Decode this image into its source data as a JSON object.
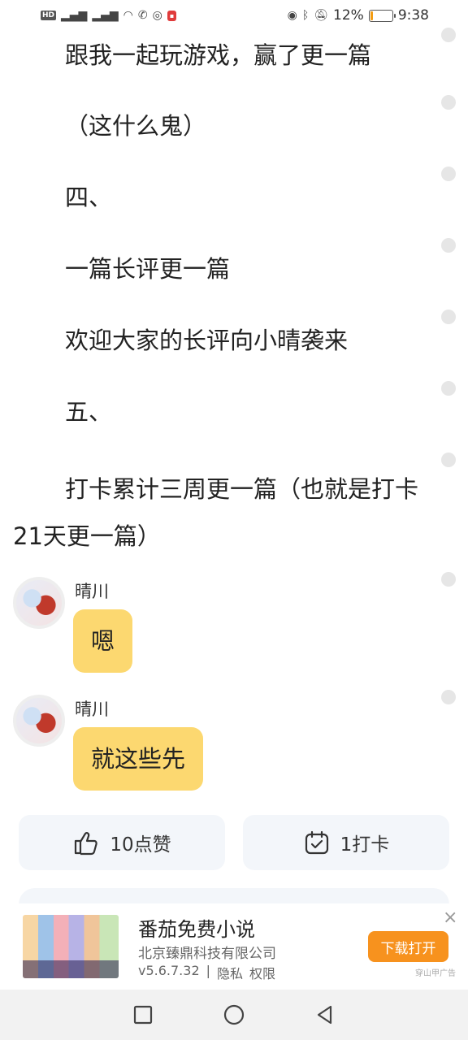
{
  "status_bar": {
    "left_icons": [
      "hd-icon",
      "5g-signal-icon",
      "signal-icon",
      "wifi-icon",
      "call-icon",
      "qq-icon",
      "app-notification-icon"
    ],
    "battery_percent": "12%",
    "battery_level": 0.12,
    "time": "9:38"
  },
  "story": {
    "paragraphs": [
      "跟我一起玩游戏，赢了更一篇",
      "（这什么鬼）",
      "四、",
      "一篇长评更一篇",
      "欢迎大家的长评向小晴袭来",
      "五、",
      "打卡累计三周更一篇（也就是打卡21天更一篇）"
    ]
  },
  "messages": [
    {
      "sender": "晴川",
      "text": "嗯"
    },
    {
      "sender": "晴川",
      "text": "就这些先"
    }
  ],
  "actions": {
    "like_label": "10点赞",
    "checkin_label": "1打卡"
  },
  "ad": {
    "title": "番茄免费小说",
    "company": "北京臻鼎科技有限公司",
    "version": "v5.6.7.32",
    "separator": "|",
    "privacy": "隐私",
    "permissions": "权限",
    "download_button": "下载打开",
    "close_label": "×",
    "source": "穿山甲广告"
  },
  "colors": {
    "bubble": "#fcd870",
    "ad_button": "#f7921e",
    "battery": "#f39c12"
  }
}
